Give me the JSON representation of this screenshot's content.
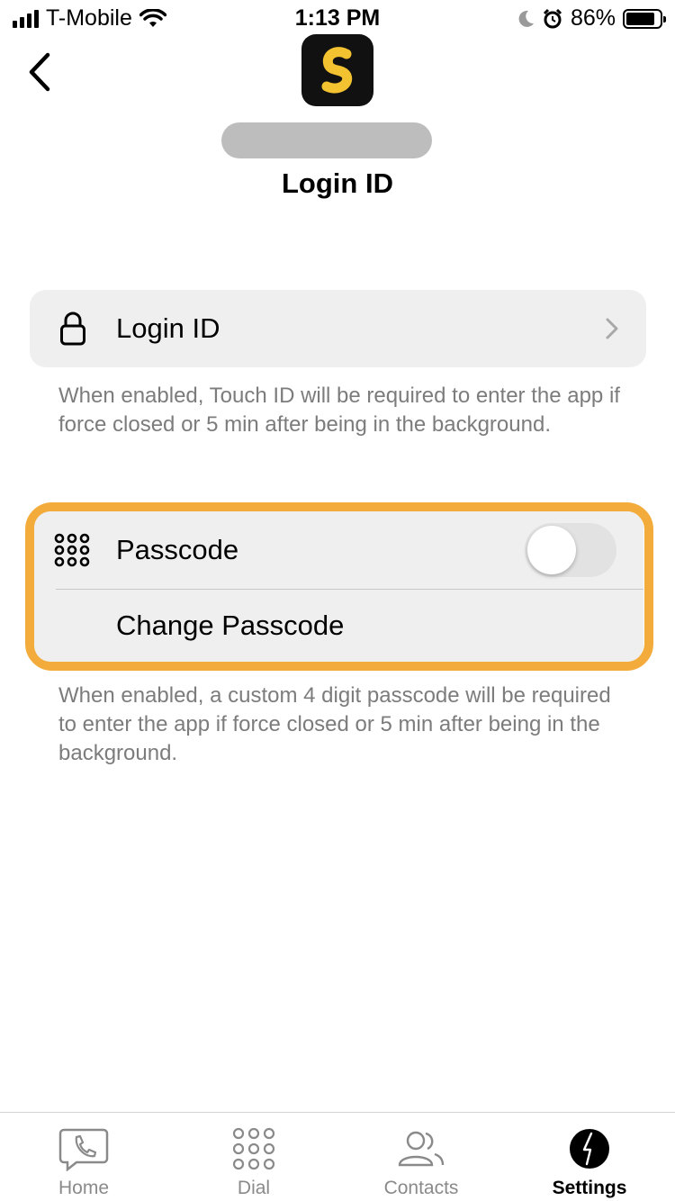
{
  "status_bar": {
    "carrier": "T-Mobile",
    "time": "1:13 PM",
    "battery_percent": "86%",
    "battery_level": 0.86,
    "icons": [
      "signal-icon",
      "wifi-icon",
      "moon-icon",
      "alarm-icon",
      "battery-icon"
    ]
  },
  "header": {
    "title": "Login ID",
    "back_icon": "chevron-left-icon",
    "logo_icon": "app-logo-icon"
  },
  "security": {
    "login_id": {
      "label": "Login ID",
      "icon": "lock-icon",
      "description": "When enabled, Touch ID will be required to enter the app if force closed or 5 min after being in the background."
    },
    "passcode": {
      "label": "Passcode",
      "icon": "keypad-icon",
      "enabled": false,
      "change_label": "Change Passcode",
      "description": "When enabled, a custom 4 digit passcode will be required to enter the app if force closed or 5 min after being in the background."
    },
    "highlight_color": "#f3ac3b"
  },
  "tab_bar": {
    "tabs": [
      {
        "label": "Home",
        "icon": "phone-bubble-icon",
        "active": false
      },
      {
        "label": "Dial",
        "icon": "keypad-icon",
        "active": false
      },
      {
        "label": "Contacts",
        "icon": "contacts-icon",
        "active": false
      },
      {
        "label": "Settings",
        "icon": "settings-bolt-icon",
        "active": true
      }
    ]
  },
  "colors": {
    "accent_logo": "#f2c230",
    "card_bg": "#efefef",
    "secondary_text": "#7c7c7c"
  }
}
